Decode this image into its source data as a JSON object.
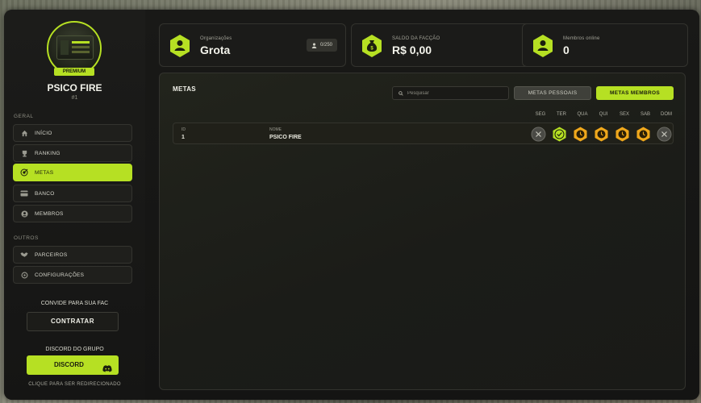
{
  "sidebar": {
    "premium_label": "PREMIUM",
    "org_name": "PSICO FIRE",
    "org_id": "#1",
    "section_geral": "GERAL",
    "section_outros": "OUTROS",
    "items": [
      {
        "label": "INÍCIO",
        "icon": "home-icon"
      },
      {
        "label": "RANKING",
        "icon": "trophy-icon"
      },
      {
        "label": "METAS",
        "icon": "target-icon"
      },
      {
        "label": "BANCO",
        "icon": "card-icon"
      },
      {
        "label": "MEMBROS",
        "icon": "members-icon"
      },
      {
        "label": "PARCEIROS",
        "icon": "handshake-icon"
      },
      {
        "label": "CONFIGURAÇÕES",
        "icon": "settings-icon"
      }
    ],
    "invite_title": "CONVIDE PARA SUA FAC",
    "invite_button": "CONTRATAR",
    "discord_title": "DISCORD DO GRUPO",
    "discord_button": "DISCORD",
    "discord_footer": "CLIQUE PARA SER REDIRECIONADO"
  },
  "stats": {
    "org": {
      "label": "Organizações",
      "value": "Grota",
      "member_count": "0/250"
    },
    "balance": {
      "label": "SALDO DA FACÇÃO",
      "value": "R$ 0,00"
    },
    "online": {
      "label": "Membros online",
      "value": "0"
    }
  },
  "metas": {
    "title": "METAS",
    "search_placeholder": "Pesquisar",
    "tab_personal": "METAS PESSOAIS",
    "tab_members": "METAS MEMBROS",
    "days": [
      "SEG",
      "TER",
      "QUA",
      "QUI",
      "SEX",
      "SAB",
      "DOM"
    ],
    "col_id": "ID",
    "col_name": "NOME",
    "rows": [
      {
        "id": "1",
        "name": "PSICO FIRE",
        "status": [
          "missed",
          "done",
          "pending",
          "pending",
          "pending",
          "pending",
          "missed"
        ]
      }
    ]
  },
  "colors": {
    "accent": "#b6e023",
    "pending": "#f0a81c",
    "missed": "#5a5a55"
  }
}
